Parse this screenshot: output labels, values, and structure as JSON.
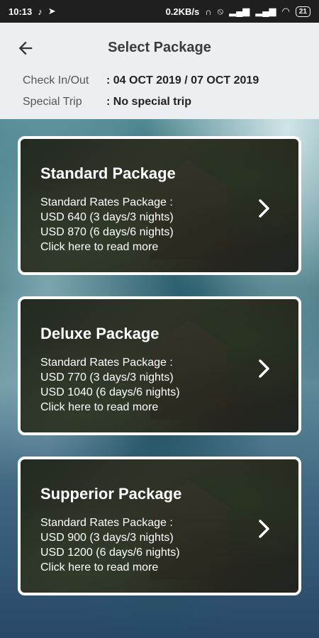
{
  "status_bar": {
    "time": "10:13",
    "net_speed": "0.2KB/s",
    "battery": "21"
  },
  "header": {
    "title": "Select Package",
    "check_label": "Check In/Out",
    "check_value": ": 04 OCT 2019 / 07 OCT 2019",
    "trip_label": "Special Trip",
    "trip_value": ": No special trip"
  },
  "packages": [
    {
      "name": "Standard Package",
      "rates_title": "Standard Rates Package :",
      "rate_1": "USD 640 (3 days/3 nights)",
      "rate_2": "USD 870 (6 days/6 nights)",
      "more": "Click here to read more"
    },
    {
      "name": "Deluxe Package",
      "rates_title": "Standard Rates Package :",
      "rate_1": "USD 770 (3 days/3 nights)",
      "rate_2": "USD 1040 (6 days/6 nights)",
      "more": "Click here to read more"
    },
    {
      "name": "Supperior Package",
      "rates_title": "Standard Rates Package :",
      "rate_1": "USD 900 (3 days/3 nights)",
      "rate_2": "USD 1200 (6 days/6 nights)",
      "more": "Click here to read more"
    }
  ],
  "colors": {
    "header_bg": "#eceff1",
    "status_bg": "#1f1f1f",
    "card_border": "#ffffff"
  },
  "icons": [
    "tiktok-icon",
    "telegram-icon",
    "headphones-icon",
    "mute-icon",
    "signal-icon",
    "wifi-icon",
    "battery-icon",
    "back-arrow-icon",
    "chevron-right-icon"
  ]
}
